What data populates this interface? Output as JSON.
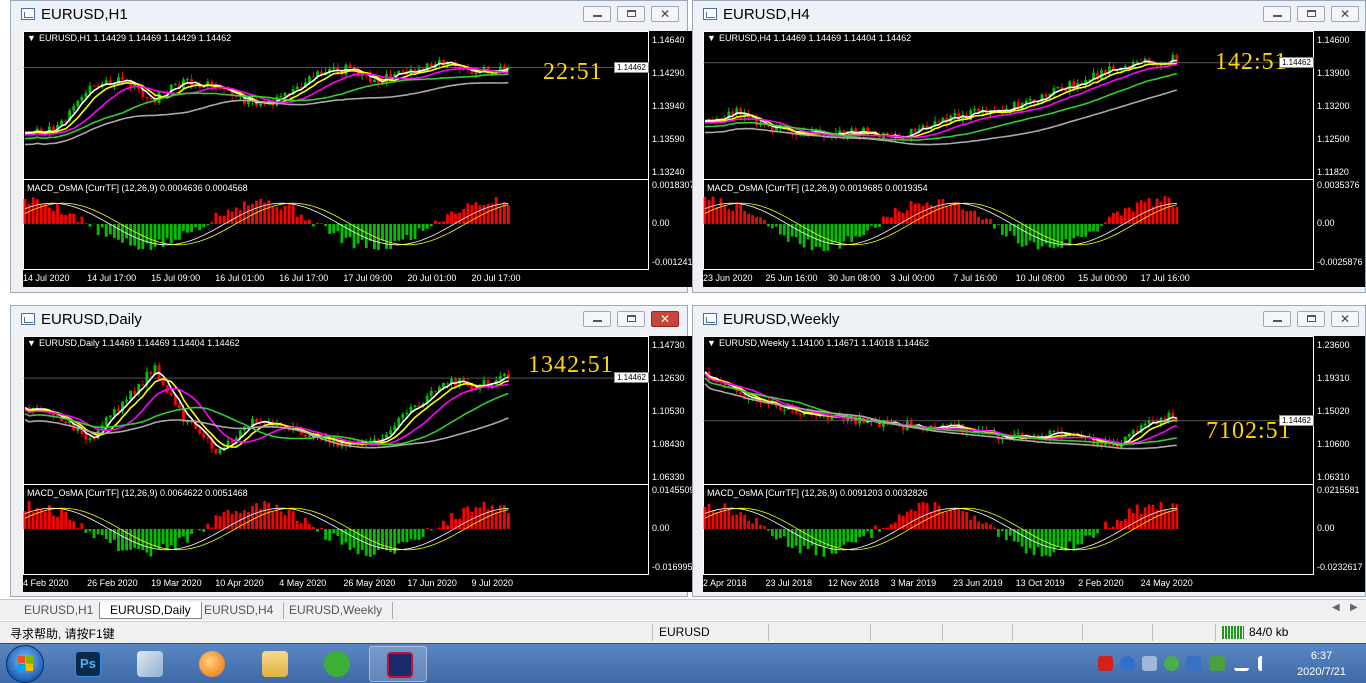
{
  "windows": [
    {
      "title": "EURUSD,H1",
      "info": "EURUSD,H1  1.14429 1.14469 1.14429 1.14462",
      "countdown": "22:51",
      "price_tag": "1.14462",
      "price_axis": [
        "1.14640",
        "1.14290",
        "1.13940",
        "1.13590",
        "1.13240"
      ],
      "macd_info": "MACD_OsMA [CurrTF] (12,26,9) 0.0004636 0.0004568",
      "macd_axis": [
        "0.0018307",
        "0.00",
        "-0.001241"
      ],
      "time_axis": [
        "14 Jul 2020",
        "14 Jul 17:00",
        "15 Jul 09:00",
        "16 Jul 01:00",
        "16 Jul 17:00",
        "17 Jul 09:00",
        "20 Jul 01:00",
        "20 Jul 17:00"
      ]
    },
    {
      "title": "EURUSD,H4",
      "info": "EURUSD,H4  1.14469 1.14469 1.14404 1.14462",
      "countdown": "142:51",
      "price_tag": "1.14462",
      "price_axis": [
        "1.14600",
        "1.13900",
        "1.13200",
        "1.12500",
        "1.11820"
      ],
      "macd_info": "MACD_OsMA [CurrTF] (12,26,9) 0.0019685 0.0019354",
      "macd_axis": [
        "0.0035376",
        "0.00",
        "-0.0025876"
      ],
      "time_axis": [
        "23 Jun 2020",
        "25 Jun 16:00",
        "30 Jun 08:00",
        "3 Jul 00:00",
        "7 Jul 16:00",
        "10 Jul 08:00",
        "15 Jul 00:00",
        "17 Jul 16:00"
      ]
    },
    {
      "title": "EURUSD,Daily",
      "info": "EURUSD,Daily  1.14469 1.14469 1.14404 1.14462",
      "countdown": "1342:51",
      "price_tag": "1.14462",
      "price_axis": [
        "1.14730",
        "1.12630",
        "1.10530",
        "1.08430",
        "1.06330"
      ],
      "macd_info": "MACD_OsMA [CurrTF] (12,26,9) 0.0064622 0.0051468",
      "macd_axis": [
        "0.0145509",
        "0.00",
        "-0.016995"
      ],
      "time_axis": [
        "4 Feb 2020",
        "26 Feb 2020",
        "19 Mar 2020",
        "10 Apr 2020",
        "4 May 2020",
        "26 May 2020",
        "17 Jun 2020",
        "9 Jul 2020"
      ]
    },
    {
      "title": "EURUSD,Weekly",
      "info": "EURUSD,Weekly  1.14100 1.14671 1.14018 1.14462",
      "countdown": "7102:51",
      "price_tag": "1.14462",
      "price_axis": [
        "1.23600",
        "1.19310",
        "1.15020",
        "1.10600",
        "1.06310"
      ],
      "macd_info": "MACD_OsMA [CurrTF] (12,26,9) 0.0091203 0.0032826",
      "macd_axis": [
        "0.0215581",
        "0.00",
        "-0.0232617"
      ],
      "time_axis": [
        "2 Apr 2018",
        "23 Jul 2018",
        "12 Nov 2018",
        "3 Mar 2019",
        "23 Jun 2019",
        "13 Oct 2019",
        "2 Feb 2020",
        "24 May 2020"
      ]
    }
  ],
  "tabs": [
    "EURUSD,H1",
    "EURUSD,Daily",
    "EURUSD,H4",
    "EURUSD,Weekly"
  ],
  "active_tab": "EURUSD,Daily",
  "status": {
    "help": "寻求帮助, 请按F1键",
    "symbol": "EURUSD",
    "traffic": "84/0 kb"
  },
  "taskbar": {
    "apps": [
      "photoshop-icon",
      "paint-icon",
      "browser-icon",
      "folder-icon",
      "wechat-icon",
      "trading-icon"
    ],
    "clock_time": "6:37",
    "clock_date": "2020/7/21"
  },
  "colors": {
    "bull": "#00c000",
    "bear": "#ff0000",
    "ma_white": "#ffffff",
    "ma_yellow": "#ffff00",
    "ma_magenta": "#ff00ff",
    "ma_green": "#32cd32",
    "ma_gray": "#a9a9a9",
    "countdown": "#ffd700"
  }
}
